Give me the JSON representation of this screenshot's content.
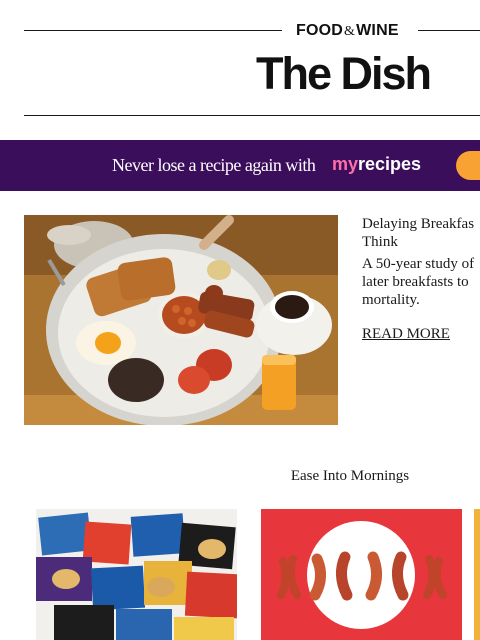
{
  "header": {
    "brand_left": "FOOD",
    "brand_amp": "&",
    "brand_right": "WINE",
    "newsletter_title": "The Dish"
  },
  "banner": {
    "text": "Never lose a recipe again with",
    "logo_my": "my",
    "logo_recipes": "recipes",
    "background": "#3b0e5c",
    "button_color": "#f7a233"
  },
  "feature": {
    "image": "full-breakfast-plate-photo",
    "title_line1": "Delaying Breakfas",
    "title_line2": "Think",
    "desc_line1": "A 50-year study of",
    "desc_line2": "later breakfasts to",
    "desc_line3": "mortality.",
    "read_more": "READ MORE"
  },
  "section": {
    "heading": "Ease Into Mornings"
  },
  "cards": [
    {
      "image": "frozen-breakfast-sandwich-boxes-photo"
    },
    {
      "image": "bacon-strips-on-red-photo"
    },
    {
      "image": "partial-card-photo"
    }
  ]
}
